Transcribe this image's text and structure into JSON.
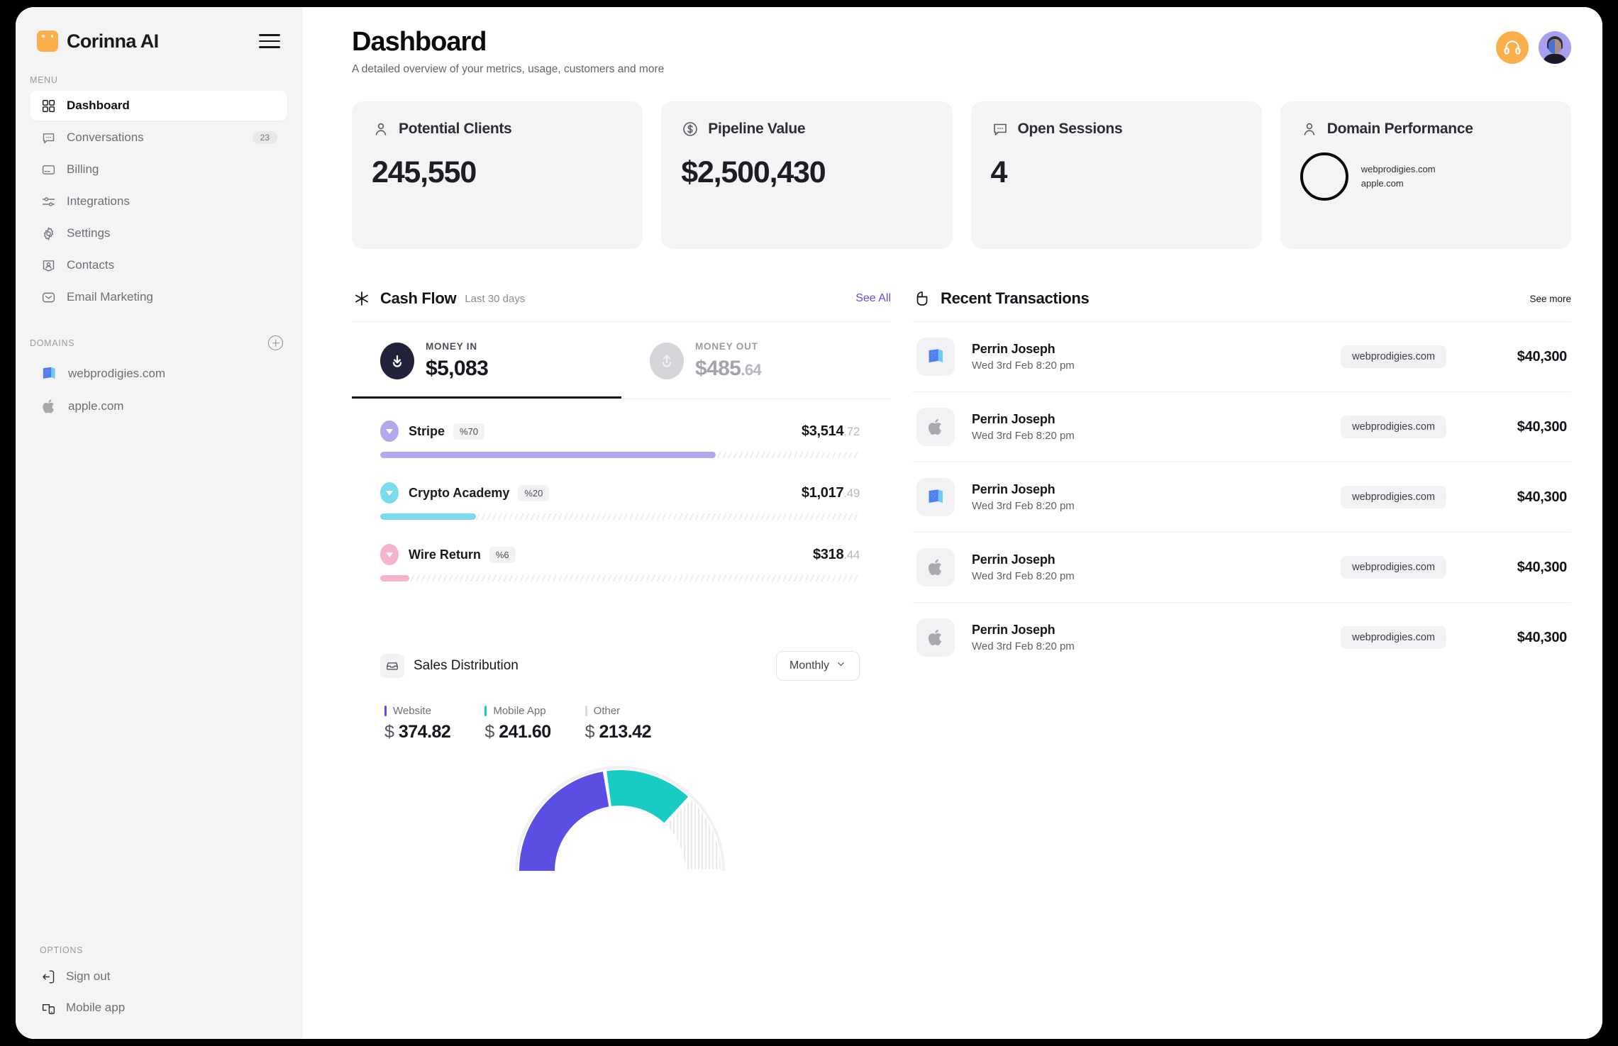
{
  "brand": {
    "name": "Corinna AI",
    "logo_icon": "square-logo-icon",
    "menu_icon": "hamburger-icon"
  },
  "sidebar": {
    "menu_label": "MENU",
    "items": [
      {
        "label": "Dashboard",
        "icon": "grid-icon",
        "active": true,
        "badge": ""
      },
      {
        "label": "Conversations",
        "icon": "chat-bubble-icon",
        "active": false,
        "badge": "23"
      },
      {
        "label": "Billing",
        "icon": "credit-card-icon",
        "active": false,
        "badge": ""
      },
      {
        "label": "Integrations",
        "icon": "sliders-icon",
        "active": false,
        "badge": ""
      },
      {
        "label": "Settings",
        "icon": "gear-icon",
        "active": false,
        "badge": ""
      },
      {
        "label": "Contacts",
        "icon": "contact-icon",
        "active": false,
        "badge": ""
      },
      {
        "label": "Email Marketing",
        "icon": "envelope-icon",
        "active": false,
        "badge": ""
      }
    ],
    "domains_label": "DOMAINS",
    "add_domain_icon": "plus-circle-icon",
    "domains": [
      {
        "label": "webprodigies.com",
        "icon": "webprodigies-book-icon"
      },
      {
        "label": "apple.com",
        "icon": "apple-icon"
      }
    ],
    "options_label": "OPTIONS",
    "options": [
      {
        "label": "Sign out",
        "icon": "sign-out-icon"
      },
      {
        "label": "Mobile app",
        "icon": "mobile-app-icon"
      }
    ]
  },
  "header": {
    "title": "Dashboard",
    "subtitle": "A detailed overview of your metrics, usage, customers and more",
    "support_icon": "headphones-icon",
    "avatar_name": "user-avatar"
  },
  "stats": [
    {
      "label": "Potential Clients",
      "icon": "user-icon",
      "value": "245,550"
    },
    {
      "label": "Pipeline Value",
      "icon": "dollar-circle-icon",
      "value": "$2,500,430"
    },
    {
      "label": "Open Sessions",
      "icon": "chat-bubble-icon",
      "value": "4"
    },
    {
      "label": "Domain Performance",
      "icon": "user-icon",
      "value": "",
      "legend": [
        "webprodigies.com",
        "apple.com"
      ]
    }
  ],
  "cash_flow": {
    "icon": "asterisk-icon",
    "title": "Cash Flow",
    "subtitle": "Last 30 days",
    "link": "See All",
    "tabs": [
      {
        "caption": "MONEY IN",
        "amount": "$5,083",
        "decimals": "",
        "active": true,
        "icon": "arrow-down-circle-icon"
      },
      {
        "caption": "MONEY OUT",
        "amount": "$485",
        "decimals": ".64",
        "active": false,
        "icon": "arrow-up-circle-icon"
      }
    ],
    "sources": [
      {
        "name": "Stripe",
        "percent": "%70",
        "amount": "$3,514",
        "decimals": ".72",
        "color": "#b3a8ee",
        "fill_pct": 70
      },
      {
        "name": "Crypto Academy",
        "percent": "%20",
        "amount": "$1,017",
        "decimals": ".49",
        "color": "#7adbee",
        "fill_pct": 20
      },
      {
        "name": "Wire Return",
        "percent": "%6",
        "amount": "$318",
        "decimals": ".44",
        "color": "#f4b4cd",
        "fill_pct": 6
      }
    ]
  },
  "sales_distribution": {
    "icon": "inbox-icon",
    "title": "Sales Distribution",
    "period_select": {
      "value": "Monthly",
      "chevron_icon": "chevron-down-icon"
    },
    "legend": [
      {
        "name": "Website",
        "value": "374.82",
        "currency": "$",
        "color": "#5b4ee3"
      },
      {
        "name": "Mobile App",
        "value": "241.60",
        "currency": "$",
        "color": "#18ccc4"
      },
      {
        "name": "Other",
        "value": "213.42",
        "currency": "$",
        "color": "#d8d8dd"
      }
    ]
  },
  "chart_data": {
    "type": "pie",
    "title": "Sales Distribution",
    "subtype": "semicircle-gauge",
    "labels": [
      "Website",
      "Mobile App",
      "Other"
    ],
    "values": [
      374.82,
      241.6,
      213.42
    ],
    "percentages": [
      45.1,
      29.1,
      25.8
    ],
    "colors": [
      "#5b4ee3",
      "#18ccc4",
      "#e6e6ea"
    ],
    "legend_position": "top",
    "units": "$"
  },
  "transactions": {
    "icon": "bag-icon",
    "title": "Recent Transactions",
    "link": "See more",
    "rows": [
      {
        "icon": "webprodigies-book-icon",
        "name": "Perrin Joseph",
        "date": "Wed 3rd Feb 8:20 pm",
        "tag": "webprodigies.com",
        "amount": "$40,300"
      },
      {
        "icon": "apple-icon",
        "name": "Perrin Joseph",
        "date": "Wed 3rd Feb 8:20 pm",
        "tag": "webprodigies.com",
        "amount": "$40,300"
      },
      {
        "icon": "webprodigies-book-icon",
        "name": "Perrin Joseph",
        "date": "Wed 3rd Feb 8:20 pm",
        "tag": "webprodigies.com",
        "amount": "$40,300"
      },
      {
        "icon": "apple-icon",
        "name": "Perrin Joseph",
        "date": "Wed 3rd Feb 8:20 pm",
        "tag": "webprodigies.com",
        "amount": "$40,300"
      },
      {
        "icon": "apple-icon",
        "name": "Perrin Joseph",
        "date": "Wed 3rd Feb 8:20 pm",
        "tag": "webprodigies.com",
        "amount": "$40,300"
      }
    ]
  }
}
